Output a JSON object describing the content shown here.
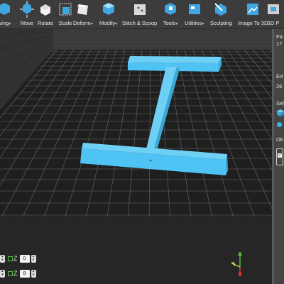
{
  "toolbar": {
    "items": [
      {
        "label": "wing",
        "caret": true,
        "icon": "drawing-icon"
      },
      {
        "label": "Move",
        "caret": false,
        "icon": "move-icon"
      },
      {
        "label": "Rotate",
        "caret": false,
        "icon": "rotate-icon"
      },
      {
        "label": "Scale",
        "caret": false,
        "icon": "scale-icon"
      },
      {
        "label": "Deform",
        "caret": true,
        "icon": "deform-icon"
      },
      {
        "label": "Modify",
        "caret": true,
        "icon": "modify-icon"
      },
      {
        "label": "Stitch & Scoop",
        "caret": false,
        "icon": "stitch-scoop-icon"
      },
      {
        "label": "Tools",
        "caret": true,
        "icon": "tools-icon"
      },
      {
        "label": "Utilities",
        "caret": true,
        "icon": "utilities-icon"
      },
      {
        "label": "Sculpting",
        "caret": false,
        "icon": "sculpting-icon"
      },
      {
        "label": "Image To 3D",
        "caret": false,
        "icon": "image-to-3d-icon"
      },
      {
        "label": "3D P",
        "caret": false,
        "icon": "3d-print-icon"
      }
    ],
    "caret_glyph": "▾"
  },
  "right_panel": {
    "fa_label": "Fa",
    "fa_value": "17",
    "ed_label": "Ed",
    "ed_value": "26",
    "sel_label": "Sele",
    "ob_label": "Ob"
  },
  "coords": {
    "row1": {
      "axis": "Z",
      "value": "0"
    },
    "row2": {
      "axis": "Z",
      "value": "8"
    }
  },
  "colors": {
    "toolbar_icon": "#3ea6e0",
    "model": "#4fc3f3",
    "grid_floor": "#1d1d1d",
    "grid_line": "#6f6f6f",
    "wall": "#3a3a3a",
    "axis_x": "#e33b3b",
    "axis_y": "#55c83c",
    "axis_z": "#d9d14a"
  }
}
